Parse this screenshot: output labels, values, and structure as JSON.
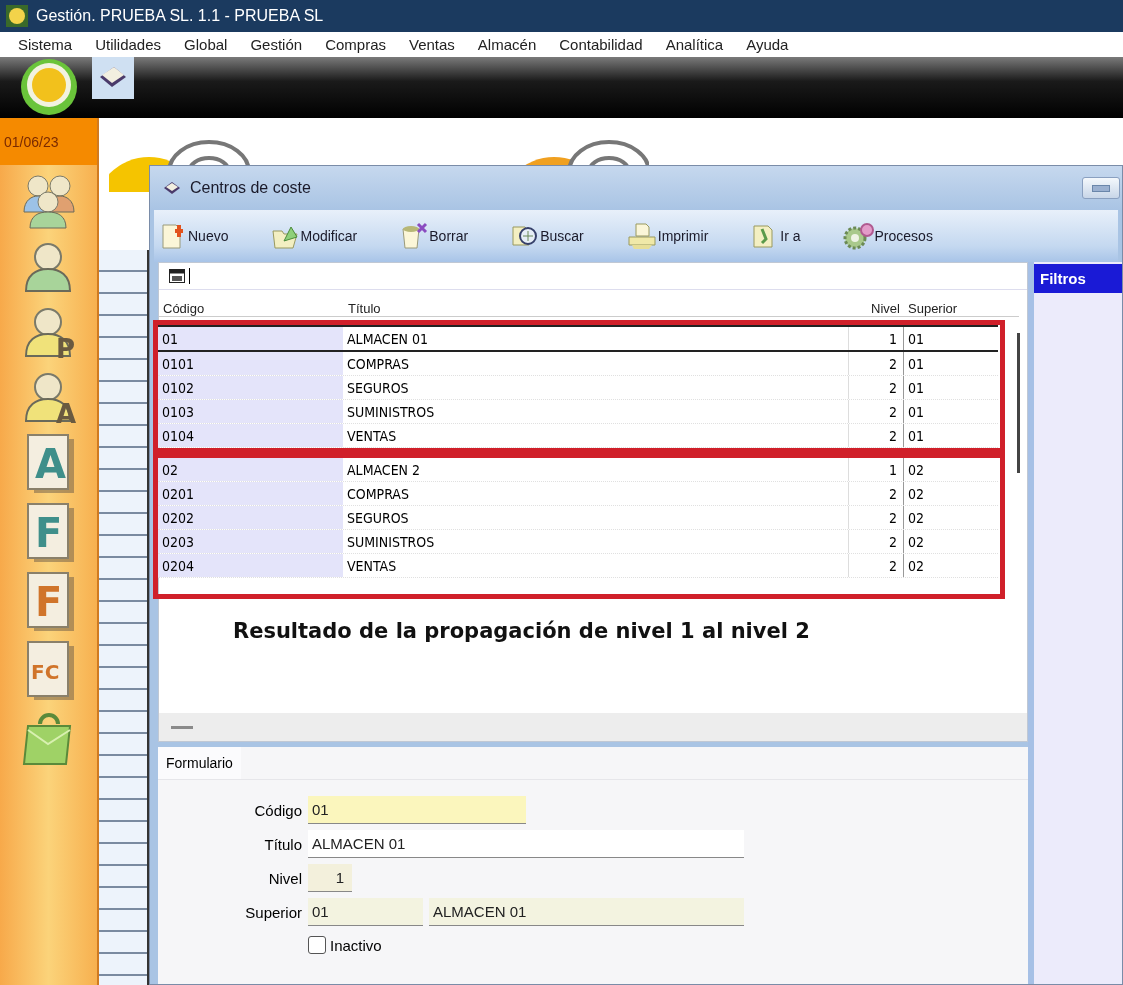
{
  "window": {
    "title": "Gestión. PRUEBA SL. 1.1 - PRUEBA SL"
  },
  "menu": [
    "Sistema",
    "Utilidades",
    "Global",
    "Gestión",
    "Compras",
    "Ventas",
    "Almacén",
    "Contabilidad",
    "Analítica",
    "Ayuda"
  ],
  "sidebar": {
    "date": "01/06/23",
    "items": [
      {
        "kind": "group"
      },
      {
        "kind": "person"
      },
      {
        "kind": "person",
        "badge": "P"
      },
      {
        "kind": "person",
        "badge": "A"
      },
      {
        "kind": "document",
        "badge": "A",
        "color": "#3f8f8a"
      },
      {
        "kind": "document",
        "badge": "F",
        "color": "#3f8f8a"
      },
      {
        "kind": "document",
        "badge": "F",
        "color": "#d0742a"
      },
      {
        "kind": "document",
        "badge": "FC",
        "color": "#d0742a"
      },
      {
        "kind": "bag"
      }
    ]
  },
  "child_window": {
    "title": "Centros de coste",
    "toolbar": [
      {
        "kind": "new",
        "label": "Nuevo"
      },
      {
        "kind": "modify",
        "label": "Modificar"
      },
      {
        "kind": "delete",
        "label": "Borrar"
      },
      {
        "kind": "search",
        "label": "Buscar"
      },
      {
        "kind": "print",
        "label": "Imprimir"
      },
      {
        "kind": "goto",
        "label": "Ir a"
      },
      {
        "kind": "process",
        "label": "Procesos"
      }
    ],
    "grid": {
      "columns": [
        "Código",
        "Título",
        "Nivel",
        "Superior"
      ],
      "row_groups": [
        {
          "rows": [
            {
              "cells": [
                "01",
                "ALMACEN 01",
                "1",
                "01"
              ],
              "selected": true
            },
            {
              "cells": [
                "0101",
                "COMPRAS",
                "2",
                "01"
              ],
              "selected": false
            },
            {
              "cells": [
                "0102",
                "SEGUROS",
                "2",
                "01"
              ],
              "selected": false
            },
            {
              "cells": [
                "0103",
                "SUMINISTROS",
                "2",
                "01"
              ],
              "selected": false
            },
            {
              "cells": [
                "0104",
                "VENTAS",
                "2",
                "01"
              ],
              "selected": false
            }
          ]
        },
        {
          "rows": [
            {
              "cells": [
                "02",
                "ALMACEN 2",
                "1",
                "02"
              ],
              "selected": false
            },
            {
              "cells": [
                "0201",
                "COMPRAS",
                "2",
                "02"
              ],
              "selected": false
            },
            {
              "cells": [
                "0202",
                "SEGUROS",
                "2",
                "02"
              ],
              "selected": false
            },
            {
              "cells": [
                "0203",
                "SUMINISTROS",
                "2",
                "02"
              ],
              "selected": false
            },
            {
              "cells": [
                "0204",
                "VENTAS",
                "2",
                "02"
              ],
              "selected": false
            }
          ]
        }
      ]
    },
    "annotation": "Resultado de la propagación de nivel 1 al nivel 2",
    "filters_title": "Filtros",
    "form": {
      "tab": "Formulario",
      "fields": [
        {
          "label": "Código",
          "kind": "key",
          "values": [
            "01"
          ]
        },
        {
          "label": "Título",
          "kind": "text",
          "values": [
            "ALMACEN 01"
          ]
        },
        {
          "label": "Nivel",
          "kind": "number",
          "values": [
            "1"
          ]
        },
        {
          "label": "Superior",
          "kind": "lookup",
          "values": [
            "01",
            "ALMACEN 01"
          ]
        }
      ],
      "inactive": {
        "label": "Inactivo",
        "checked": false
      }
    }
  }
}
